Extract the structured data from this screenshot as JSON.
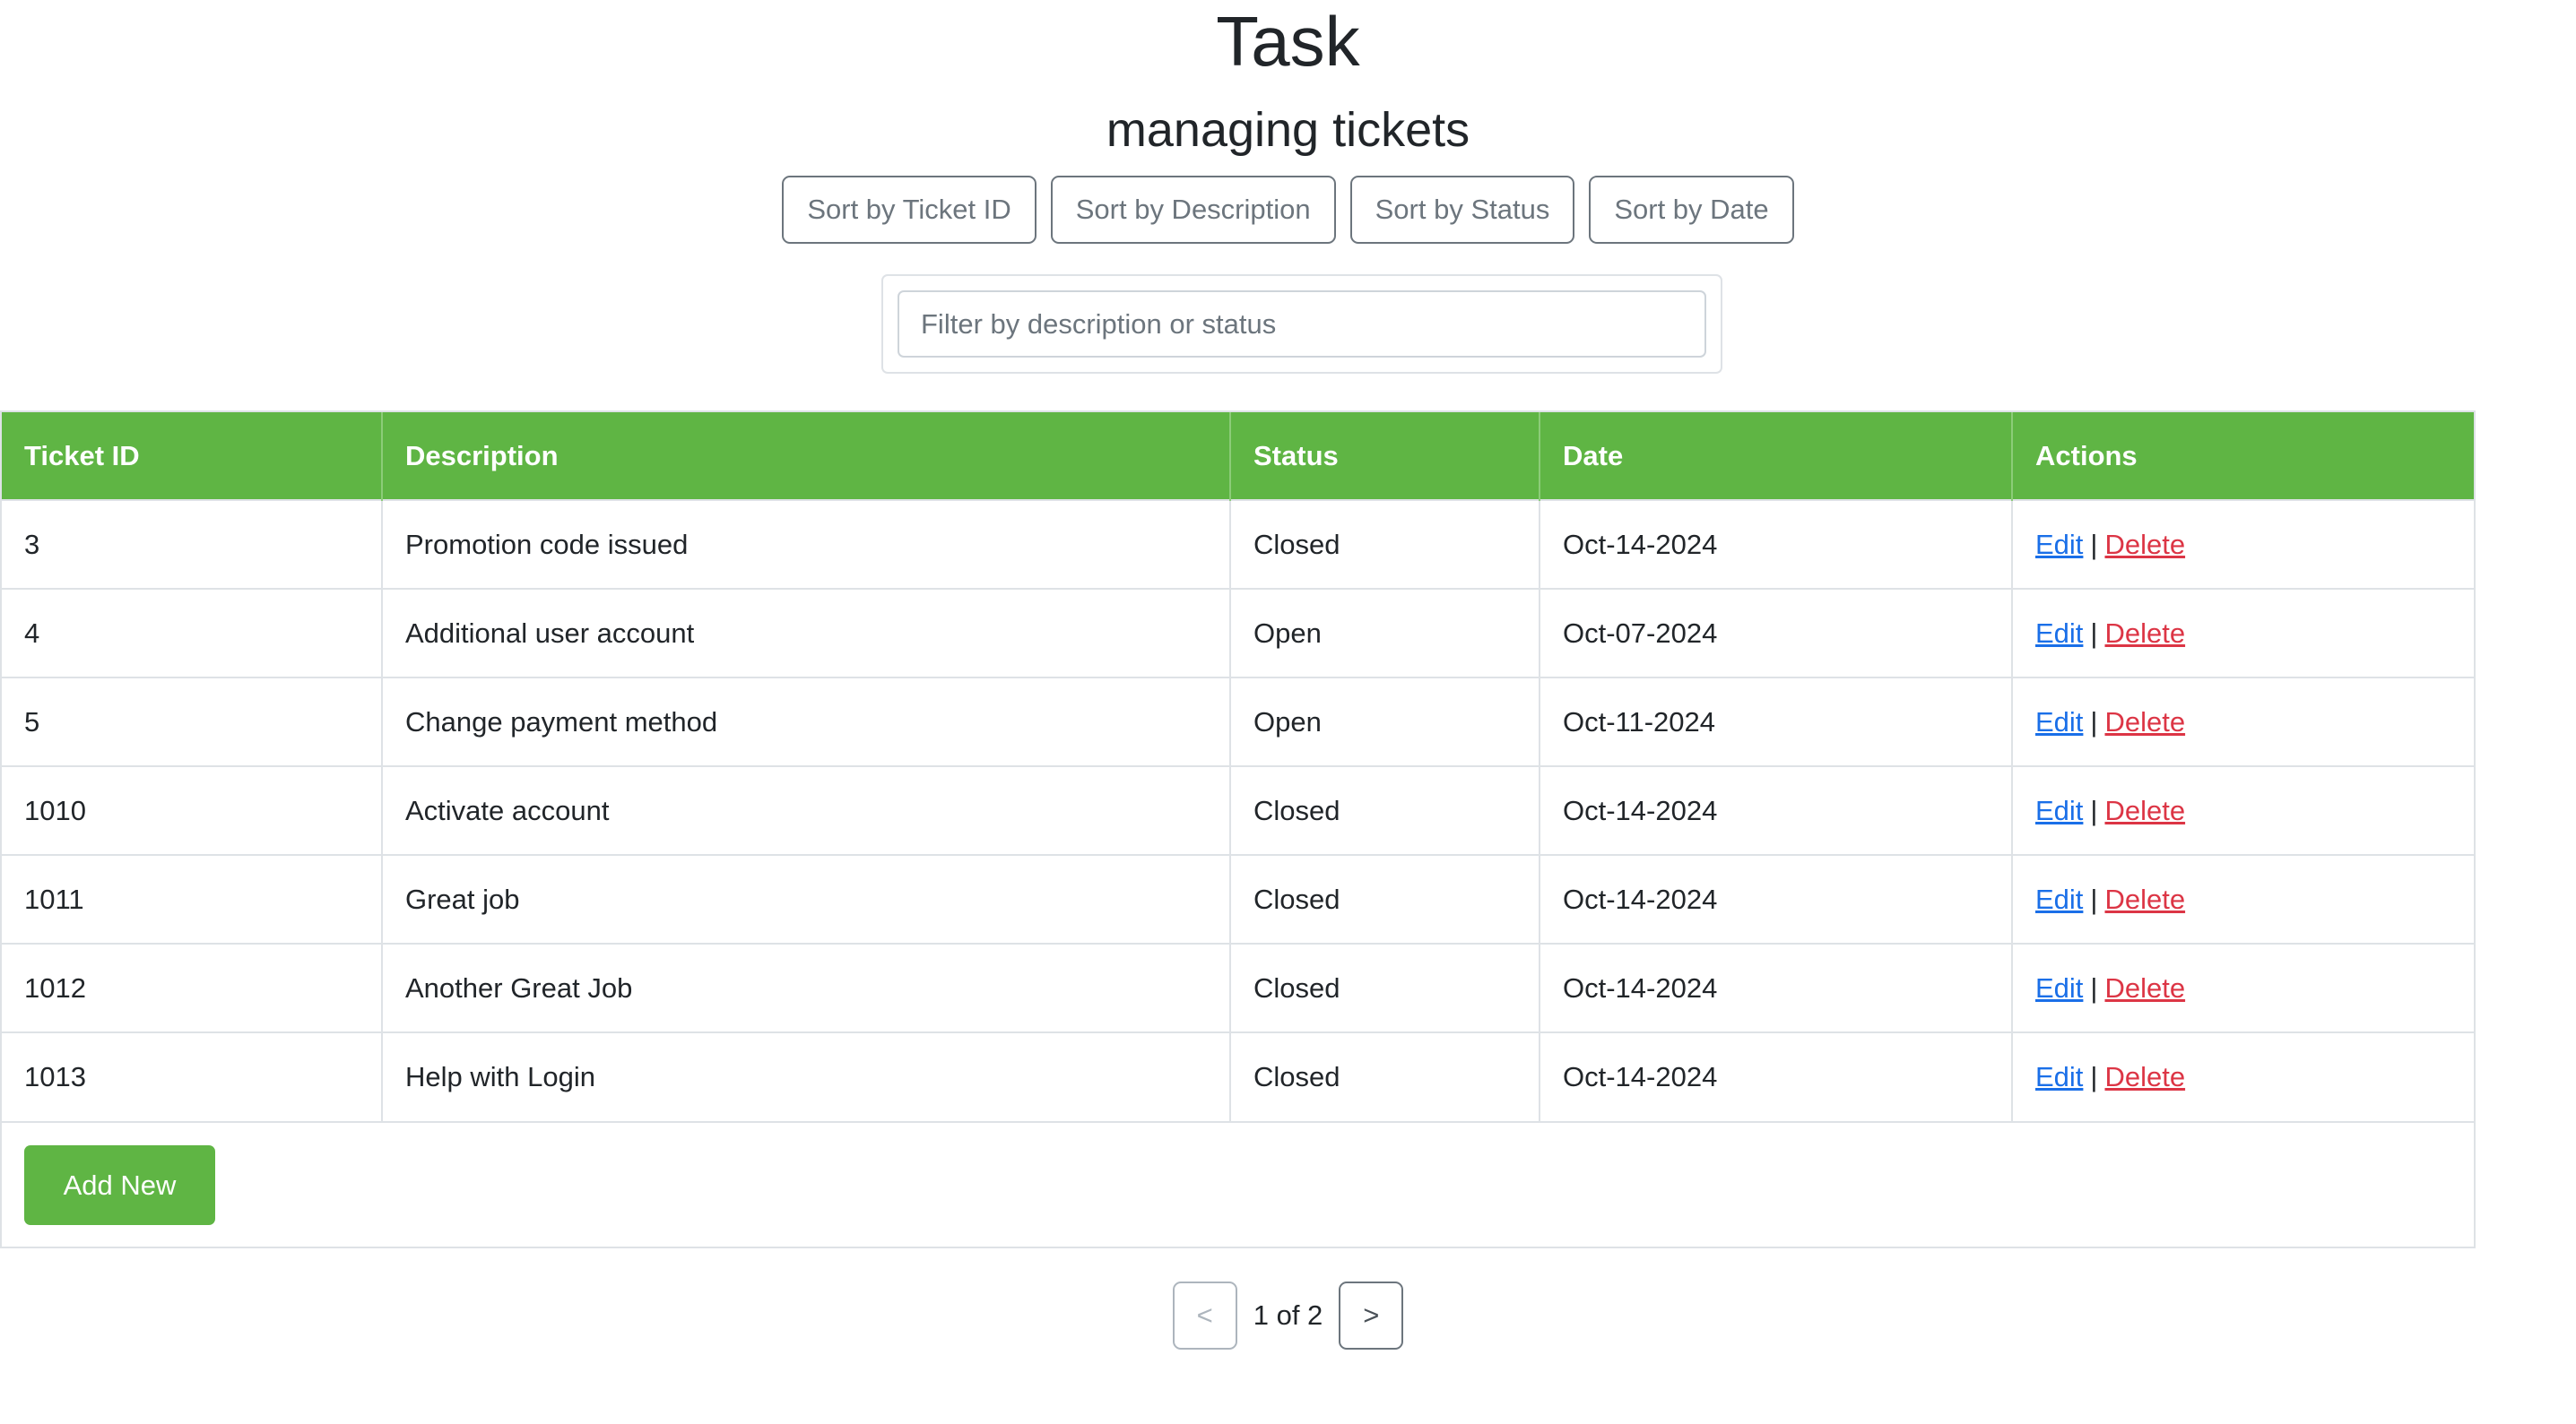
{
  "header": {
    "title": "Task",
    "subtitle": "managing tickets"
  },
  "sort_buttons": [
    {
      "label": "Sort by Ticket ID"
    },
    {
      "label": "Sort by Description"
    },
    {
      "label": "Sort by Status"
    },
    {
      "label": "Sort by Date"
    }
  ],
  "filter": {
    "placeholder": "Filter by description or status",
    "value": ""
  },
  "table": {
    "columns": [
      "Ticket ID",
      "Description",
      "Status",
      "Date",
      "Actions"
    ],
    "rows": [
      {
        "id": "3",
        "description": "Promotion code issued",
        "status": "Closed",
        "date": "Oct-14-2024"
      },
      {
        "id": "4",
        "description": "Additional user account",
        "status": "Open",
        "date": "Oct-07-2024"
      },
      {
        "id": "5",
        "description": "Change payment method",
        "status": "Open",
        "date": "Oct-11-2024"
      },
      {
        "id": "1010",
        "description": "Activate account",
        "status": "Closed",
        "date": "Oct-14-2024"
      },
      {
        "id": "1011",
        "description": "Great job",
        "status": "Closed",
        "date": "Oct-14-2024"
      },
      {
        "id": "1012",
        "description": "Another Great Job",
        "status": "Closed",
        "date": "Oct-14-2024"
      },
      {
        "id": "1013",
        "description": "Help with Login",
        "status": "Closed",
        "date": "Oct-14-2024"
      }
    ],
    "actions": {
      "edit_label": "Edit",
      "separator": "|",
      "delete_label": "Delete"
    },
    "add_button_label": "Add New"
  },
  "pagination": {
    "prev_label": "<",
    "next_label": ">",
    "text": "1 of 2"
  },
  "colors": {
    "accent": "#5fb544",
    "link": "#1a6fe8",
    "danger": "#dc3545"
  }
}
